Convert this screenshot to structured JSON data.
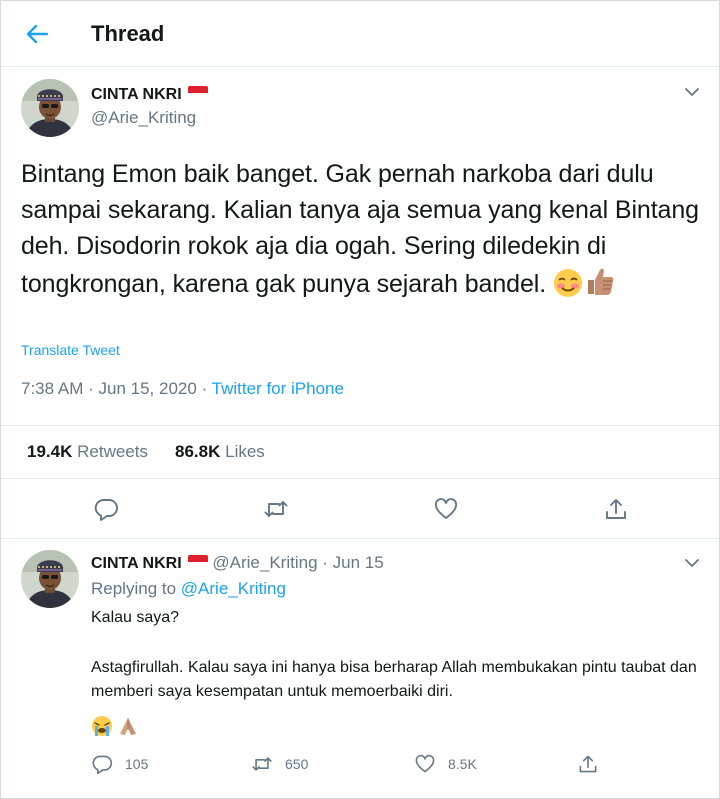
{
  "header": {
    "title": "Thread"
  },
  "main_tweet": {
    "name": "CINTA NKRI",
    "handle": "@Arie_Kriting",
    "text": "Bintang Emon baik banget. Gak pernah narkoba dari dulu sampai sekarang. Kalian tanya aja semua yang kenal Bintang deh. Disodorin rokok aja dia ogah. Sering diledekin di tongkrongan, karena gak punya sejarah bandel.",
    "emojis": [
      "smiling-blush-emoji",
      "thumbs-up-emoji"
    ],
    "translate_label": "Translate Tweet",
    "time": "7:38 AM",
    "date": "Jun 15, 2020",
    "separator": "·",
    "source": "Twitter for iPhone",
    "retweets_count": "19.4K",
    "retweets_label": "Retweets",
    "likes_count": "86.8K",
    "likes_label": "Likes"
  },
  "reply_tweet": {
    "name": "CINTA NKRI",
    "handle": "@Arie_Kriting",
    "separator": "·",
    "date": "Jun 15",
    "replying_label": "Replying to",
    "replying_to": "@Arie_Kriting",
    "line1": "Kalau saya?",
    "line2": "Astagfirullah. Kalau saya ini hanya bisa berharap Allah membukakan pintu taubat dan memberi saya kesempatan untuk memoerbaiki diri.",
    "emojis": [
      "crying-face-emoji",
      "folded-hands-emoji"
    ],
    "reply_count": "105",
    "retweet_count": "650",
    "like_count": "8.5K"
  },
  "colors": {
    "accent": "#1da1f2",
    "text": "#14171a",
    "muted": "#657786",
    "border": "#e6ecf0"
  },
  "icons": [
    "back-arrow-icon",
    "chevron-down-icon",
    "reply-icon",
    "retweet-icon",
    "like-icon",
    "share-icon",
    "indonesia-flag-icon"
  ]
}
